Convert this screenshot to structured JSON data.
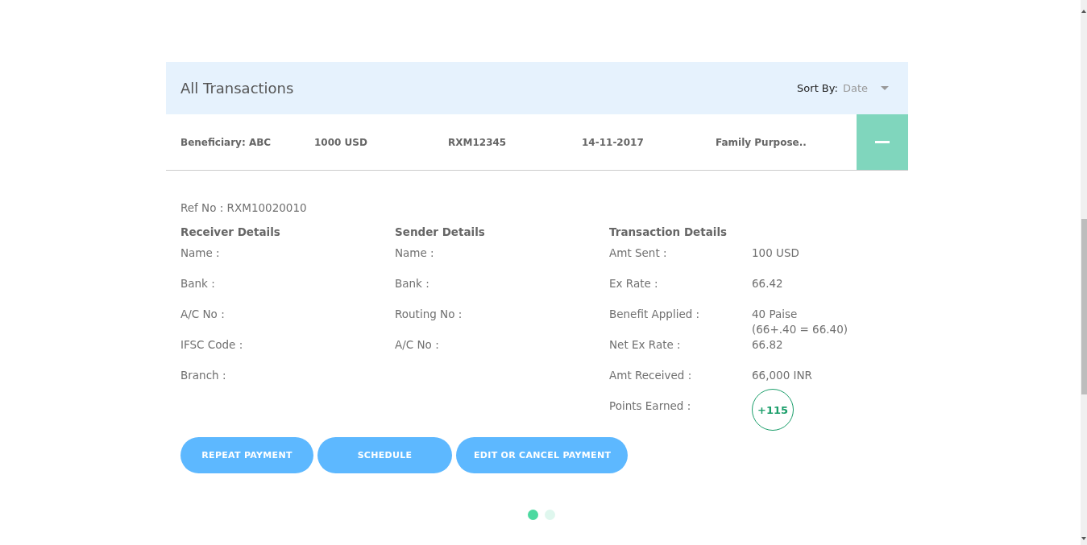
{
  "header": {
    "title": "All Transactions",
    "sort_label": "Sort By:",
    "sort_value": "Date"
  },
  "transaction": {
    "expanded": true,
    "cells": [
      "Beneficiary: ABC",
      "1000 USD",
      "RXM12345",
      "14-11-2017",
      "Family Purpose.."
    ]
  },
  "details": {
    "ref": "Ref No : RXM10020010",
    "columns": [
      {
        "title": "Receiver Details",
        "rows": [
          {
            "label": "Name :"
          },
          {
            "label": "Bank :"
          },
          {
            "label": "A/C No :"
          },
          {
            "label": "IFSC Code :"
          },
          {
            "label": "Branch :"
          }
        ]
      },
      {
        "title": "Sender Details",
        "rows": [
          {
            "label": "Name :"
          },
          {
            "label": "Bank :"
          },
          {
            "label": "Routing No :"
          },
          {
            "label": "A/C No :"
          }
        ]
      },
      {
        "title": "Transaction Details",
        "rows": [
          {
            "label": "Amt Sent :",
            "kind": "text",
            "values": [
              "100 USD"
            ]
          },
          {
            "label": "Ex Rate :",
            "kind": "text",
            "values": [
              "66.42"
            ]
          },
          {
            "label": "Benefit Applied :",
            "kind": "text",
            "values": [
              "40 Paise",
              "(66+.40 = 66.40)"
            ]
          },
          {
            "label": "Net Ex Rate :",
            "kind": "text",
            "values": [
              "66.82"
            ]
          },
          {
            "label": "Amt Received :",
            "kind": "text",
            "values": [
              "66,000 INR"
            ]
          },
          {
            "label": "Points Earned :",
            "kind": "badge",
            "values": [
              "+115"
            ]
          }
        ]
      }
    ]
  },
  "buttons": [
    "REPEAT PAYMENT",
    "SCHEDULE",
    "EDIT OR CANCEL PAYMENT"
  ],
  "pager": [
    {
      "selected": true
    },
    {
      "selected": false
    }
  ]
}
